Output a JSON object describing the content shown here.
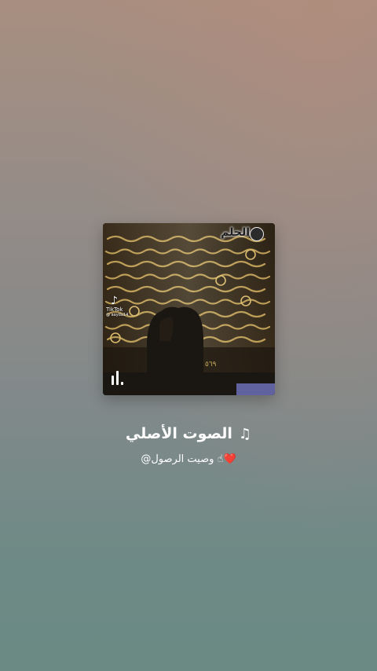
{
  "sound": {
    "title": "الصوت الأصلي",
    "music_icon": "♫",
    "author": "@وصيت الرصول ☝❤️"
  },
  "cover": {
    "caption": "الحلم",
    "tiktok_brand": "TikTok",
    "tiktok_handle": "@ aayda14",
    "page_number": "٥٦٩"
  },
  "colors": {
    "text": "#ffffff",
    "background_top": "#a88e80",
    "background_bottom": "#6b8a84",
    "gold": "#c9a85a"
  }
}
